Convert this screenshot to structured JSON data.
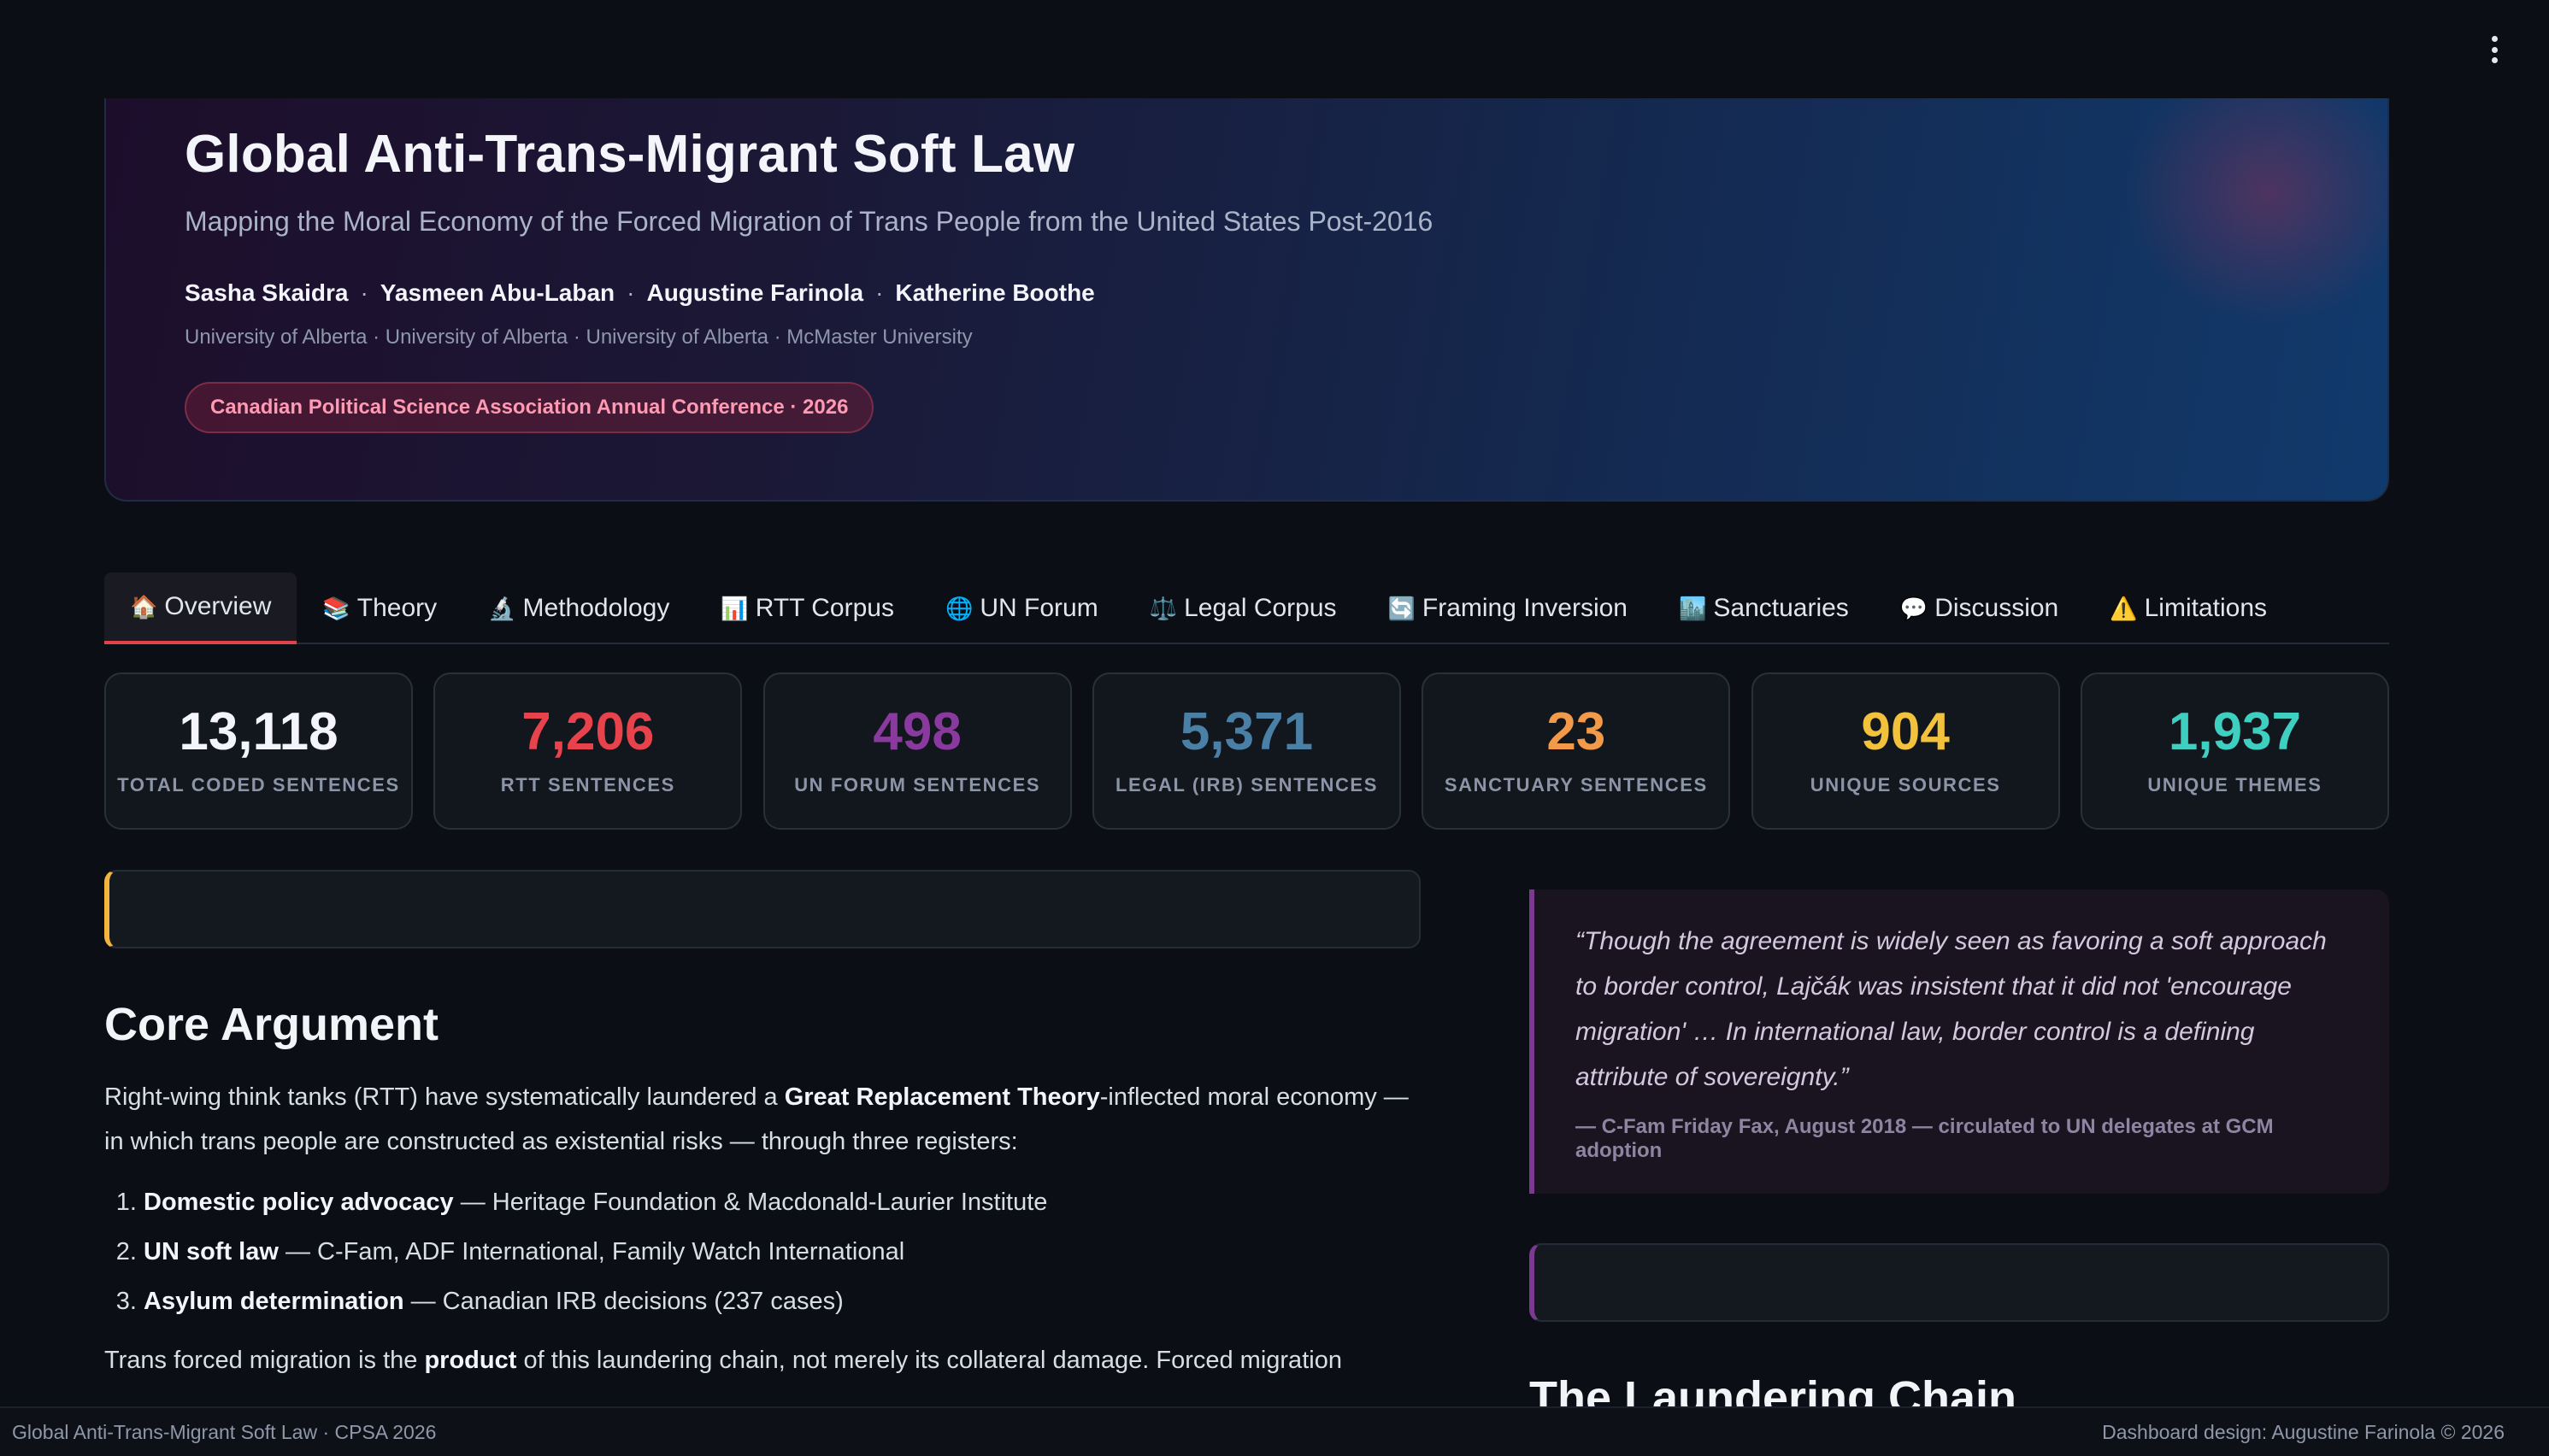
{
  "menu": {
    "icon": "kebab-menu-icon"
  },
  "hero": {
    "title": "Global Anti-Trans-Migrant Soft Law",
    "subtitle": "Mapping the Moral Economy of the Forced Migration of Trans People from the United States Post-2016",
    "authors": [
      "Sasha Skaidra",
      "Yasmeen Abu-Laban",
      "Augustine Farinola",
      "Katherine Boothe"
    ],
    "author_separator": "·",
    "affiliations": "University of Alberta · University of Alberta · University of Alberta · McMaster University",
    "conference_badge": "Canadian Political Science Association Annual Conference · 2026"
  },
  "tabs": [
    {
      "icon": "🏠",
      "label": "Overview",
      "active": true
    },
    {
      "icon": "📚",
      "label": "Theory"
    },
    {
      "icon": "🔬",
      "label": "Methodology"
    },
    {
      "icon": "📊",
      "label": "RTT Corpus"
    },
    {
      "icon": "🌐",
      "label": "UN Forum"
    },
    {
      "icon": "⚖️",
      "label": "Legal Corpus"
    },
    {
      "icon": "🔄",
      "label": "Framing Inversion"
    },
    {
      "icon": "🏙️",
      "label": "Sanctuaries"
    },
    {
      "icon": "💬",
      "label": "Discussion"
    },
    {
      "icon": "⚠️",
      "label": "Limitations"
    }
  ],
  "stats": [
    {
      "value": "13,118",
      "label": "Total Coded Sentences",
      "color": "#f4f5fa"
    },
    {
      "value": "7,206",
      "label": "RTT Sentences",
      "color": "#e8424c"
    },
    {
      "value": "498",
      "label": "UN Forum Sentences",
      "color": "#8a3a9e"
    },
    {
      "value": "5,371",
      "label": "Legal (IRB) Sentences",
      "color": "#4a7fa6"
    },
    {
      "value": "23",
      "label": "Sanctuary Sentences",
      "color": "#f39a4a"
    },
    {
      "value": "904",
      "label": "Unique Sources",
      "color": "#f2c23d"
    },
    {
      "value": "1,937",
      "label": "Unique Themes",
      "color": "#3fcfc0"
    }
  ],
  "main": {
    "core_title": "Core Argument",
    "core_p1": {
      "before": "Right-wing think tanks (RTT) have systematically laundered a ",
      "bold": "Great Replacement Theory",
      "after": "-inflected moral economy — in which trans people are constructed as existential risks — through three registers:"
    },
    "registers": [
      {
        "bold": "Domestic policy advocacy",
        "rest": " — Heritage Foundation & Macdonald-Laurier Institute"
      },
      {
        "bold": "UN soft law",
        "rest": " — C-Fam, ADF International, Family Watch International"
      },
      {
        "bold": "Asylum determination",
        "rest": " — Canadian IRB decisions (237 cases)"
      }
    ],
    "core_p2": {
      "before": "Trans forced migration is the ",
      "bold": "product",
      "after": " of this laundering chain, not merely its collateral damage. Forced migration"
    }
  },
  "sidebar": {
    "quote": "“Though the agreement is widely seen as favoring a soft approach to border control, Lajčák was insistent that it did not 'encourage migration' … In international law, border control is a defining attribute of sovereignty.”",
    "quote_cite": "— C-Fam Friday Fax, August 2018 — circulated to UN delegates at GCM adoption",
    "chain_title": "The Laundering Chain"
  },
  "footer": {
    "left": "Global Anti-Trans-Migrant Soft Law · CPSA 2026",
    "right": "Dashboard design: Augustine Farinola © 2026"
  }
}
